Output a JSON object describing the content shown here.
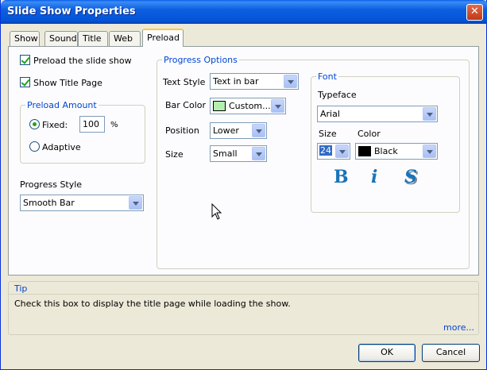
{
  "window": {
    "title": "Slide Show Properties",
    "close_glyph": "✕"
  },
  "tabs": [
    {
      "label": "Show"
    },
    {
      "label": "Sound"
    },
    {
      "label": "Title"
    },
    {
      "label": "Web"
    },
    {
      "label": "Preload",
      "active": true
    }
  ],
  "preload": {
    "preload_checkbox_label": "Preload the slide show",
    "show_title_checkbox_label": "Show Title Page",
    "amount_group_label": "Preload Amount",
    "fixed_label": "Fixed:",
    "fixed_value": "100",
    "percent_label": "%",
    "adaptive_label": "Adaptive",
    "progress_style_label": "Progress Style",
    "progress_style_value": "Smooth Bar"
  },
  "progress_options": {
    "group_label": "Progress Options",
    "text_style_label": "Text Style",
    "text_style_value": "Text in bar",
    "bar_color_label": "Bar Color",
    "bar_color_value": "Custom...",
    "bar_color_swatch": "#b3f0b0",
    "position_label": "Position",
    "position_value": "Lower",
    "size_label": "Size",
    "size_value": "Small"
  },
  "font": {
    "group_label": "Font",
    "typeface_label": "Typeface",
    "typeface_value": "Arial",
    "size_label": "Size",
    "size_value": "24",
    "color_label": "Color",
    "color_value": "Black",
    "color_swatch": "#000000",
    "bold_glyph": "B",
    "italic_glyph": "i",
    "strike_glyph": "S"
  },
  "tip": {
    "label": "Tip",
    "text": "Check this box to display the title page while loading the show.",
    "more_link": "more..."
  },
  "buttons": {
    "ok": "OK",
    "cancel": "Cancel"
  }
}
